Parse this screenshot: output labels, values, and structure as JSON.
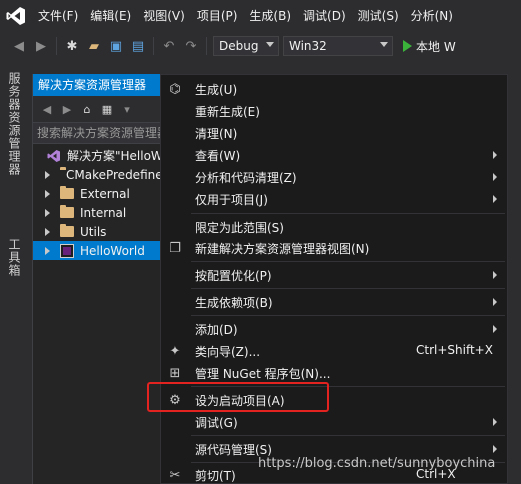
{
  "menubar": {
    "logo": "visual-studio-logo",
    "items": [
      "文件(F)",
      "编辑(E)",
      "视图(V)",
      "项目(P)",
      "生成(B)",
      "调试(D)",
      "测试(S)",
      "分析(N)"
    ]
  },
  "toolbar": {
    "config": "Debug",
    "platform": "Win32",
    "run_label": "本地 W"
  },
  "side_tabs": [
    "服务器资源管理器",
    "工具箱"
  ],
  "solution_explorer": {
    "title": "解决方案资源管理器",
    "search_placeholder": "搜索解决方案资源管理器",
    "solution_label": "解决方案\"HelloWorld\"",
    "items": [
      {
        "label": "CMakePredefinedTargets",
        "type": "folder"
      },
      {
        "label": "External",
        "type": "folder"
      },
      {
        "label": "Internal",
        "type": "folder"
      },
      {
        "label": "Utils",
        "type": "folder"
      },
      {
        "label": "HelloWorld",
        "type": "project",
        "selected": true
      }
    ]
  },
  "context_menu": {
    "items": [
      {
        "label": "生成(U)",
        "icon": "build-icon"
      },
      {
        "label": "重新生成(E)"
      },
      {
        "label": "清理(N)"
      },
      {
        "label": "查看(W)",
        "submenu": true
      },
      {
        "label": "分析和代码清理(Z)",
        "submenu": true
      },
      {
        "label": "仅用于项目(J)",
        "submenu": true
      },
      {
        "label": "限定为此范围(S)"
      },
      {
        "label": "新建解决方案资源管理器视图(N)",
        "icon": "new-view-icon"
      },
      {
        "label": "按配置优化(P)",
        "submenu": true
      },
      {
        "label": "生成依赖项(B)",
        "submenu": true
      },
      {
        "label": "添加(D)",
        "submenu": true
      },
      {
        "label": "类向导(Z)...",
        "icon": "class-wizard-icon",
        "shortcut": "Ctrl+Shift+X"
      },
      {
        "label": "管理 NuGet 程序包(N)...",
        "icon": "nuget-icon"
      },
      {
        "label": "设为启动项目(A)",
        "icon": "gear-icon",
        "highlighted": true
      },
      {
        "label": "调试(G)",
        "submenu": true
      },
      {
        "label": "源代码管理(S)",
        "submenu": true
      },
      {
        "label": "剪切(T)",
        "icon": "scissors-icon",
        "shortcut": "Ctrl+X"
      }
    ]
  },
  "watermark": "https://blog.csdn.net/sunnyboychina",
  "colors": {
    "accent": "#007acc",
    "highlight_border": "#e3231f",
    "background": "#2d2d30"
  }
}
